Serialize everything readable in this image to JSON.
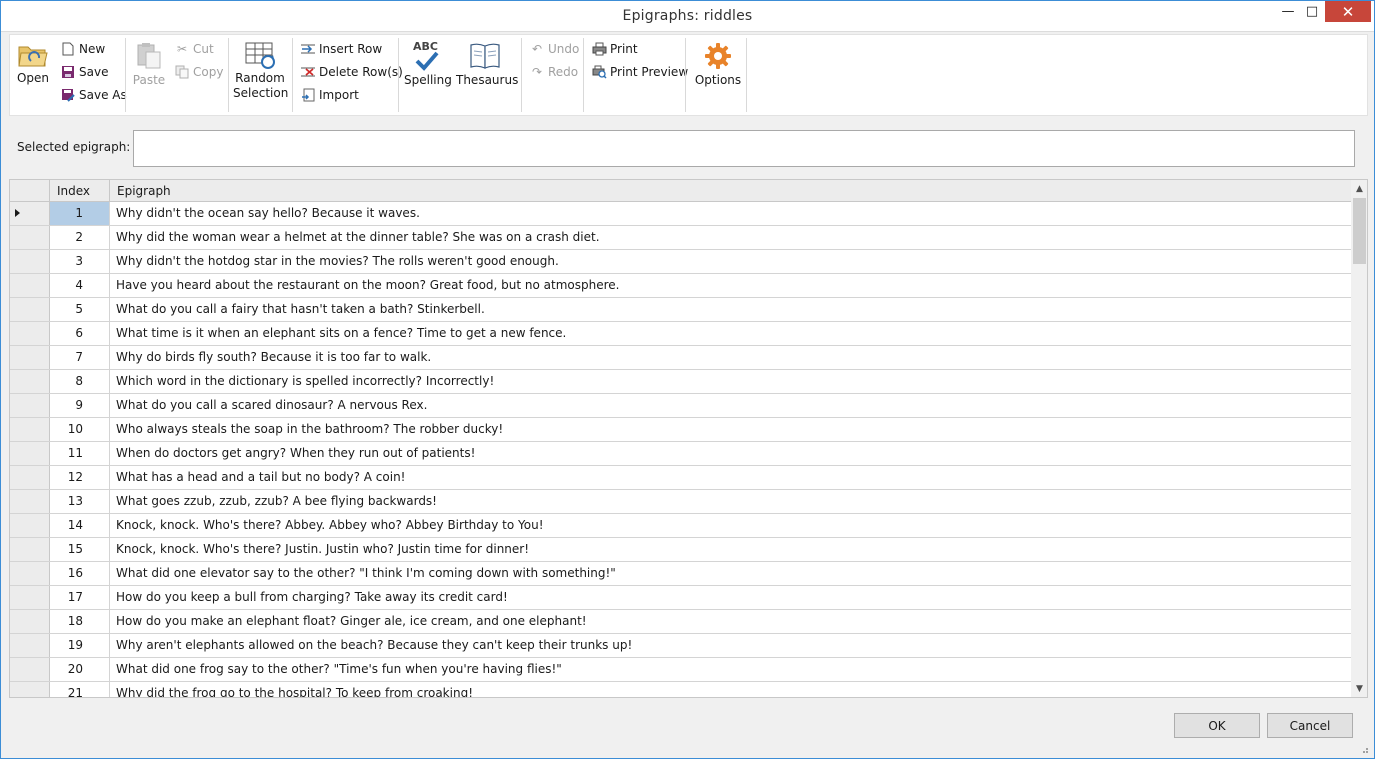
{
  "window": {
    "title": "Epigraphs:  riddles",
    "minimize": "—",
    "maximize": "□",
    "close": "✕"
  },
  "toolbar": {
    "open": "Open",
    "new": "New",
    "save": "Save",
    "save_as": "Save As",
    "paste": "Paste",
    "cut": "Cut",
    "copy": "Copy",
    "random_selection_line1": "Random",
    "random_selection_line2": "Selection",
    "insert_row": "Insert Row",
    "delete_rows": "Delete Row(s)",
    "import": "Import",
    "spelling": "Spelling",
    "spelling_icon_text": "ABC",
    "thesaurus": "Thesaurus",
    "undo": "Undo",
    "redo": "Redo",
    "print": "Print",
    "print_preview": "Print Preview",
    "options": "Options"
  },
  "selected_epigraph": {
    "label": "Selected epigraph:",
    "value": ""
  },
  "grid": {
    "columns": [
      "Index",
      "Epigraph"
    ],
    "rows": [
      {
        "index": "1",
        "text": "Why didn't the ocean say hello?  Because it waves."
      },
      {
        "index": "2",
        "text": "Why did the woman wear a helmet at the dinner table? She was on a crash diet."
      },
      {
        "index": "3",
        "text": "Why didn't the hotdog star in the movies? The rolls weren't good enough."
      },
      {
        "index": "4",
        "text": "Have you heard about the restaurant on the moon? Great food, but no atmosphere."
      },
      {
        "index": "5",
        "text": "What do you call a fairy that hasn't taken a bath? Stinkerbell."
      },
      {
        "index": "6",
        "text": "What time is it when an elephant sits on a fence? Time to get a new fence."
      },
      {
        "index": "7",
        "text": "Why do birds fly south? Because it is too far to walk."
      },
      {
        "index": "8",
        "text": "Which word in the dictionary is spelled incorrectly? Incorrectly!"
      },
      {
        "index": "9",
        "text": "What do you call a scared dinosaur? A nervous Rex."
      },
      {
        "index": "10",
        "text": "Who always steals the soap in the bathroom? The robber ducky!"
      },
      {
        "index": "11",
        "text": "When do doctors get angry? When they run out of patients!"
      },
      {
        "index": "12",
        "text": "What has a head and a tail but no body? A coin!"
      },
      {
        "index": "13",
        "text": "What goes zzub, zzub, zzub? A bee flying backwards!"
      },
      {
        "index": "14",
        "text": "Knock, knock. Who's there? Abbey. Abbey who? Abbey Birthday to You!"
      },
      {
        "index": "15",
        "text": "Knock, knock. Who's there? Justin. Justin who? Justin time for dinner!"
      },
      {
        "index": "16",
        "text": "What did one elevator say to the other? \"I think I'm coming down with something!\""
      },
      {
        "index": "17",
        "text": "How do you keep a bull from charging? Take away its credit card!"
      },
      {
        "index": "18",
        "text": "How do you make an elephant float? Ginger ale, ice cream, and one elephant!"
      },
      {
        "index": "19",
        "text": "Why aren't elephants allowed on the beach? Because they can't keep their trunks up!"
      },
      {
        "index": "20",
        "text": "What did one frog say to the other? \"Time's fun when you're having flies!\""
      },
      {
        "index": "21",
        "text": "Why did the frog go to the hospital? To keep from croaking!"
      }
    ]
  },
  "buttons": {
    "ok": "OK",
    "cancel": "Cancel"
  },
  "colors": {
    "accent": "#3c8dd6",
    "close_button": "#c7463a",
    "selected_index": "#b3cde6",
    "save_icon": "#7a2a6e",
    "options_gear": "#e8832a",
    "spelling_check": "#2c6fb3"
  }
}
